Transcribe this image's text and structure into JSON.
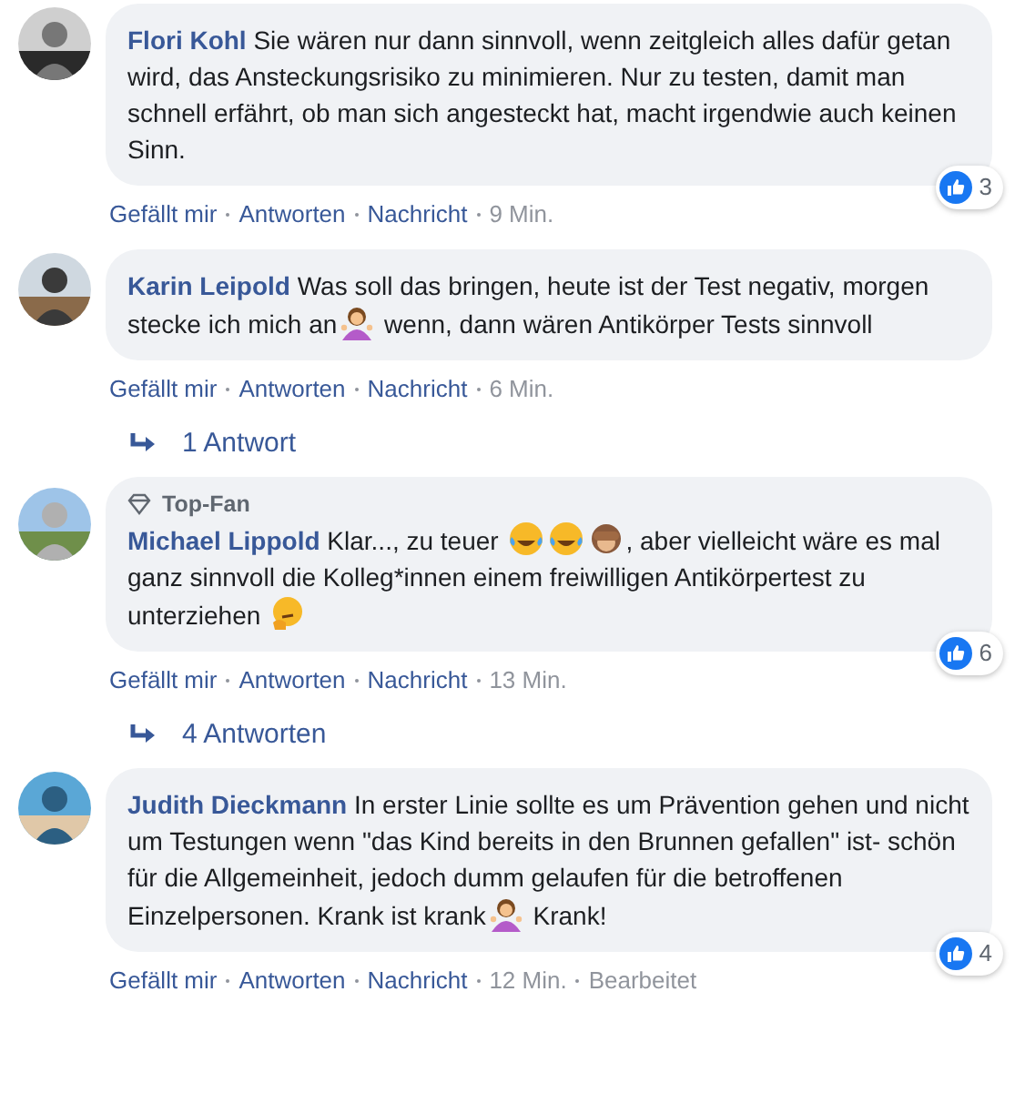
{
  "comments": [
    {
      "author": "Flori Kohl",
      "body": [
        {
          "kind": "text",
          "text": "Sie wären nur dann sinnvoll, wenn zeitgleich alles dafür getan wird, das Ansteckungsrisiko zu minimieren. Nur zu testen, damit man schnell erfährt, ob man sich angesteckt hat, macht irgendwie auch keinen Sinn."
        }
      ],
      "reactions": "3",
      "actions": [
        "Gefällt mir",
        "Antworten",
        "Nachricht"
      ],
      "time": "9 Min."
    },
    {
      "author": "Karin Leipold",
      "body": [
        {
          "kind": "text",
          "text": "Was soll das bringen, heute ist der Test negativ, morgen stecke ich mich an"
        },
        {
          "kind": "shrug"
        },
        {
          "kind": "text",
          "text": " wenn, dann wären Antikörper Tests sinnvoll"
        }
      ],
      "actions": [
        "Gefällt mir",
        "Antworten",
        "Nachricht"
      ],
      "time": "6 Min.",
      "replies": "1 Antwort"
    },
    {
      "badge": "Top-Fan",
      "author": "Michael Lippold",
      "body": [
        {
          "kind": "text",
          "text": "Klar..., zu teuer "
        },
        {
          "kind": "laugh"
        },
        {
          "kind": "laugh"
        },
        {
          "kind": "monkey"
        },
        {
          "kind": "text",
          "text": ", aber vielleicht wäre es mal ganz sinnvoll die Kolleg*innen einem freiwilligen Antikörpertest zu unterziehen "
        },
        {
          "kind": "think"
        }
      ],
      "reactions": "6",
      "actions": [
        "Gefällt mir",
        "Antworten",
        "Nachricht"
      ],
      "time": "13 Min.",
      "replies": "4 Antworten"
    },
    {
      "author": "Judith Dieckmann",
      "body": [
        {
          "kind": "text",
          "text": "In erster Linie sollte es um Prävention gehen und nicht um Testungen wenn \"das Kind bereits in den Brunnen gefallen\" ist- schön für die Allgemeinheit, jedoch dumm gelaufen für die betroffenen Einzelpersonen. Krank ist krank"
        },
        {
          "kind": "shrug"
        },
        {
          "kind": "text",
          "text": " Krank!"
        }
      ],
      "reactions": "4",
      "actions": [
        "Gefällt mir",
        "Antworten",
        "Nachricht"
      ],
      "time": "12 Min.",
      "edited": "Bearbeitet"
    }
  ]
}
